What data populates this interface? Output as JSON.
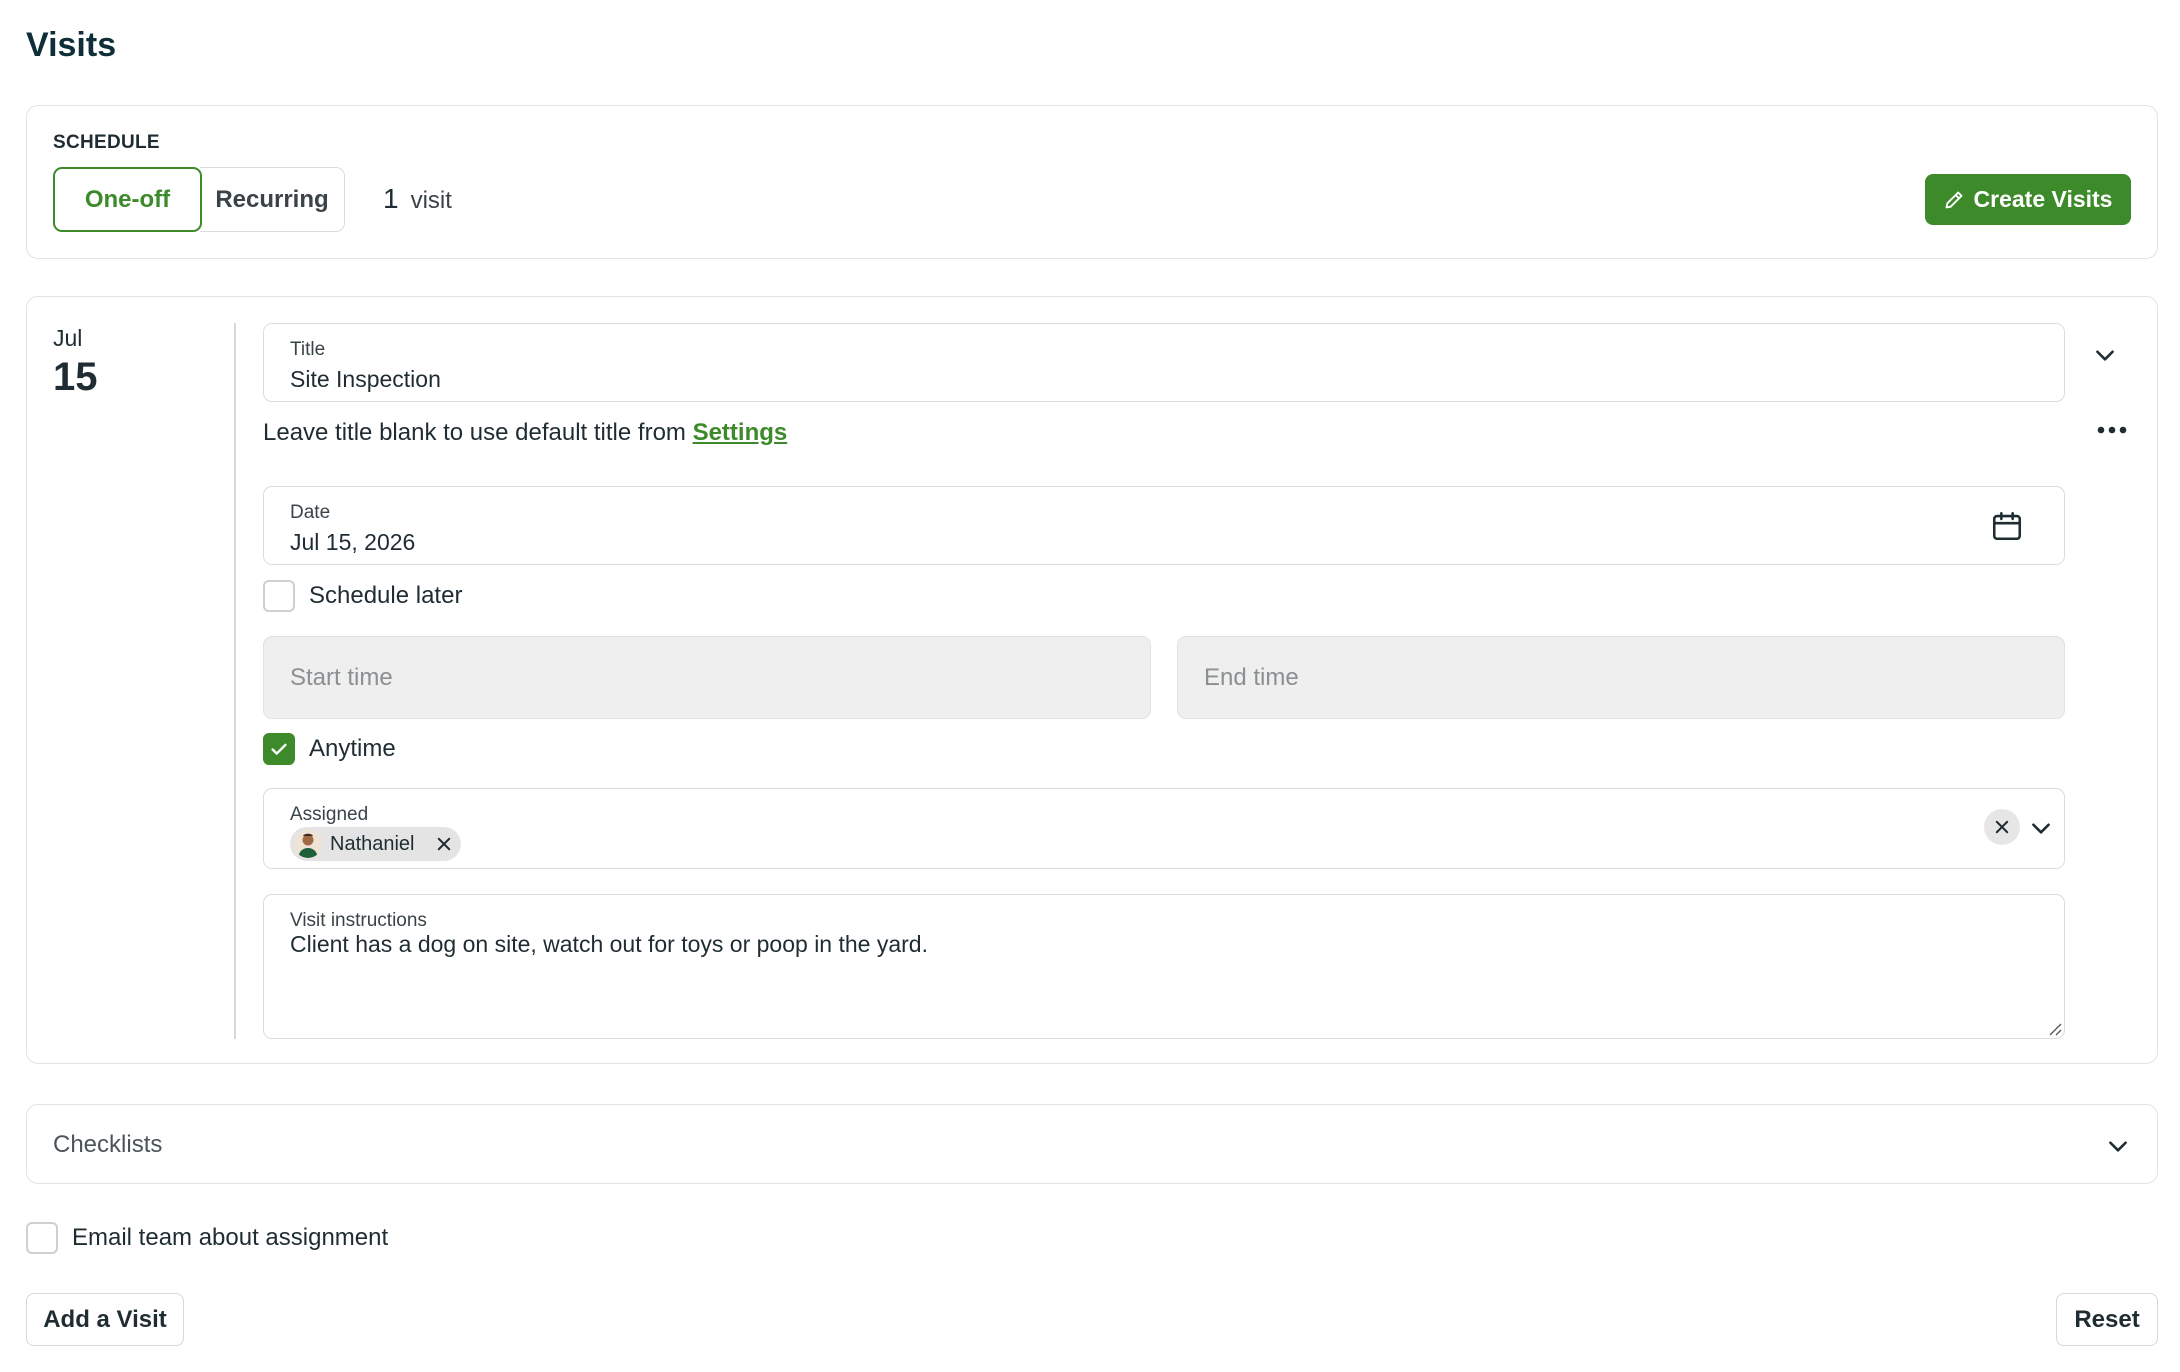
{
  "page": {
    "title": "Visits"
  },
  "schedule": {
    "label": "SCHEDULE",
    "tabs": [
      {
        "label": "One-off",
        "active": true
      },
      {
        "label": "Recurring",
        "active": false
      }
    ],
    "visit_count": "1",
    "visit_unit": "visit",
    "create_button": "Create Visits",
    "create_icon": "pencil-icon"
  },
  "visit": {
    "month": "Jul",
    "day": "15",
    "title_field": {
      "label": "Title",
      "value": "Site Inspection"
    },
    "helper": {
      "text": "Leave title blank to use default title from",
      "link": "Settings"
    },
    "date_field": {
      "label": "Date",
      "value": "Jul 15, 2026",
      "icon": "calendar-icon"
    },
    "schedule_later": {
      "label": "Schedule later",
      "checked": false
    },
    "start_time": {
      "placeholder": "Start time"
    },
    "end_time": {
      "placeholder": "End time"
    },
    "anytime": {
      "label": "Anytime",
      "checked": true
    },
    "assigned": {
      "label": "Assigned",
      "chips": [
        {
          "name": "Nathaniel"
        }
      ]
    },
    "instructions": {
      "label": "Visit instructions",
      "value": "Client has a dog on site, watch out for toys or poop in the yard."
    }
  },
  "checklists": {
    "label": "Checklists"
  },
  "email_team": {
    "label": "Email team about assignment",
    "checked": false
  },
  "footer": {
    "add_visit": "Add a Visit",
    "reset": "Reset"
  },
  "colors": {
    "accent": "#3d8a2a",
    "title": "#0e2f38",
    "border": "#dcdcdc",
    "disabled_bg": "#efefef"
  }
}
